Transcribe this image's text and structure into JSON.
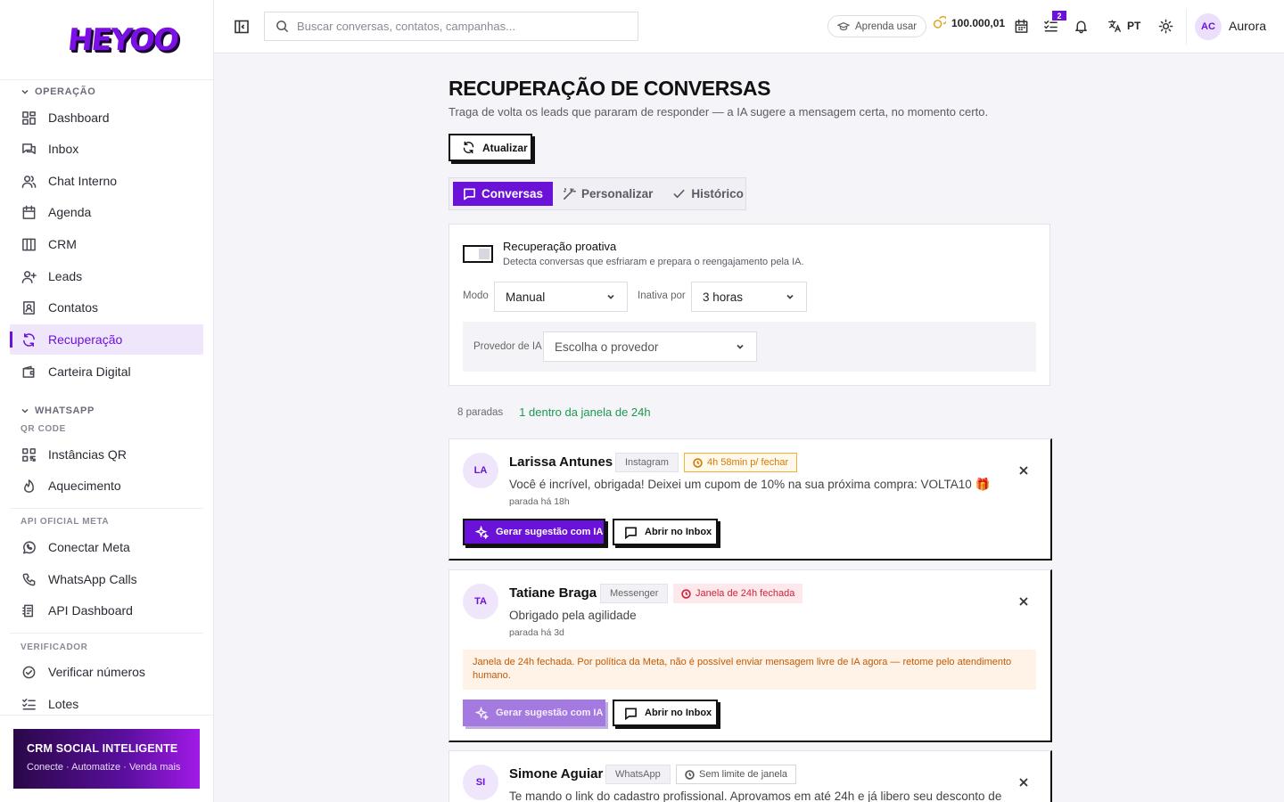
{
  "brand": {
    "logo_text": "HEYOO",
    "accent": "#6b12d9"
  },
  "sidebar": {
    "sections": [
      {
        "title": "OPERAÇÃO"
      },
      {
        "title": "WHATSAPP",
        "sub": "QR CODE"
      },
      {
        "title": "API OFICIAL META"
      },
      {
        "title": "VERIFICADOR"
      }
    ],
    "items": [
      {
        "label": "Dashboard",
        "icon": "dashboard-icon"
      },
      {
        "label": "Inbox",
        "icon": "inbox-icon"
      },
      {
        "label": "Chat Interno",
        "icon": "users-icon"
      },
      {
        "label": "Agenda",
        "icon": "calendar-icon"
      },
      {
        "label": "CRM",
        "icon": "columns-icon"
      },
      {
        "label": "Leads",
        "icon": "user-plus-icon"
      },
      {
        "label": "Contatos",
        "icon": "contact-icon"
      },
      {
        "label": "Recuperação",
        "icon": "refresh-icon",
        "active": true
      },
      {
        "label": "Carteira Digital",
        "icon": "wallet-icon"
      },
      {
        "label": "Instâncias QR",
        "icon": "qr-icon"
      },
      {
        "label": "Aquecimento",
        "icon": "flame-icon"
      },
      {
        "label": "Conectar Meta",
        "icon": "whatsapp-icon"
      },
      {
        "label": "WhatsApp Calls",
        "icon": "phone-icon"
      },
      {
        "label": "API Dashboard",
        "icon": "api-icon"
      },
      {
        "label": "Verificar números",
        "icon": "check-circle-icon"
      },
      {
        "label": "Lotes",
        "icon": "list-check-icon"
      }
    ],
    "promo": {
      "title": "CRM SOCIAL INTELIGENTE",
      "subtitle": "Conecte · Automatize · Venda mais"
    }
  },
  "topbar": {
    "search_placeholder": "Buscar conversas, contatos, campanhas...",
    "learn_label": "Aprenda usar",
    "coins": "100.000,01",
    "tasks_badge": "2",
    "language": "PT",
    "user_initials": "AC",
    "user_name": "Aurora"
  },
  "main": {
    "title": "RECUPERAÇÃO DE CONVERSAS",
    "subtitle": "Traga de volta os leads que pararam de responder — a IA sugere a mensagem certa, no momento certo.",
    "refresh_label": "Atualizar",
    "tabs": [
      {
        "label": "Conversas",
        "active": true
      },
      {
        "label": "Personalizar"
      },
      {
        "label": "Histórico"
      }
    ],
    "panel": {
      "toggle_title": "Recuperação proativa",
      "toggle_sub": "Detecta conversas que esfriaram e prepara o reengajamento pela IA.",
      "mode_label": "Modo",
      "mode_value": "Manual",
      "inactive_label": "Inativa por",
      "inactive_value": "3 horas",
      "provider_label": "Provedor de IA",
      "provider_placeholder": "Escolha o provedor"
    },
    "counts": {
      "stopped": "8 paradas",
      "in_window": "1 dentro da janela de 24h"
    },
    "cards": [
      {
        "initials": "LA",
        "name": "Larissa Antunes",
        "channel": "Instagram",
        "window": "4h 58min p/ fechar",
        "window_state": "ok",
        "message": "Você é incrível, obrigada! Deixei um cupom de 10% na sua próxima compra: VOLTA10 🎁",
        "time": "parada há 18h",
        "ai_label": "Gerar sugestão com IA",
        "inbox_label": "Abrir no Inbox"
      },
      {
        "initials": "TA",
        "name": "Tatiane Braga",
        "channel": "Messenger",
        "window": "Janela de 24h fechada",
        "window_state": "closed",
        "message": "Obrigado pela agilidade",
        "time": "parada há 3d",
        "warning": "Janela de 24h fechada. Por política da Meta, não é possível enviar mensagem livre de IA agora — retome pelo atendimento humano.",
        "ai_label": "Gerar sugestão com IA",
        "inbox_label": "Abrir no Inbox"
      },
      {
        "initials": "SI",
        "name": "Simone Aguiar",
        "channel": "WhatsApp",
        "window": "Sem limite de janela",
        "window_state": "none",
        "message": "Te mando o link do cadastro profissional. Aprovamos em até 24h e já libero seu desconto de"
      }
    ]
  }
}
